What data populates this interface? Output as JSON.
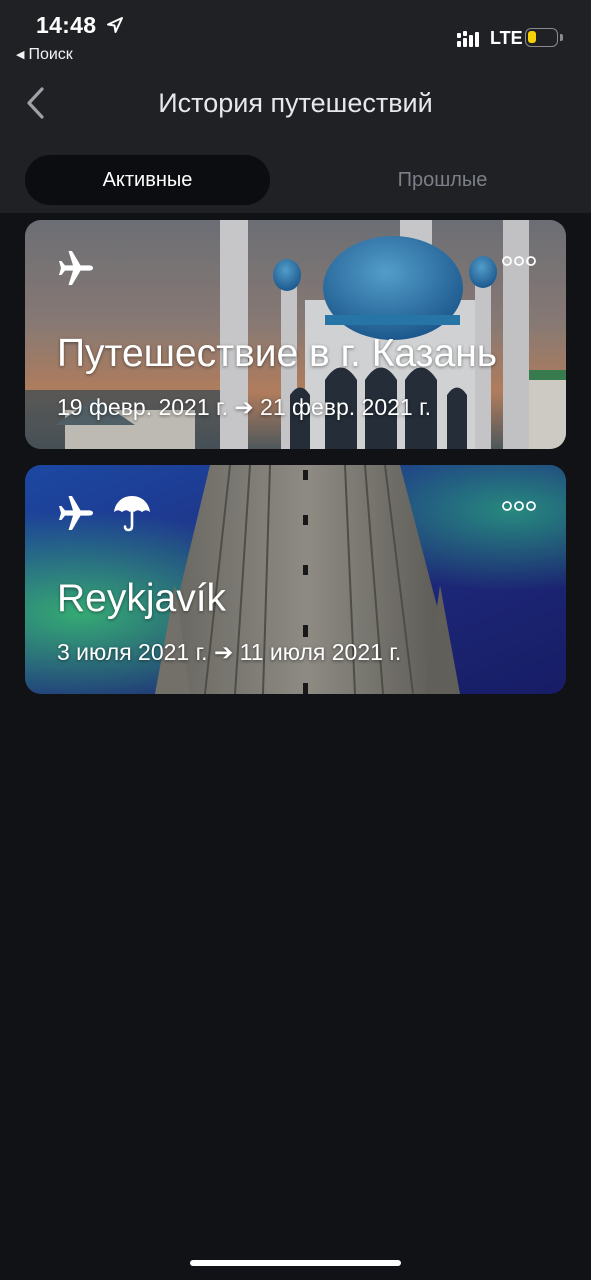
{
  "status_bar": {
    "time": "14:48",
    "back_app": "Поиск",
    "network": "LTE",
    "battery_level": 0.3,
    "battery_color": "#f5d10a"
  },
  "nav": {
    "title": "История путешествий"
  },
  "tabs": [
    {
      "label": "Активные",
      "active": true
    },
    {
      "label": "Прошлые",
      "active": false
    }
  ],
  "trips": [
    {
      "title": "Путешествие в г. Казань",
      "dates": "19 февр. 2021 г. ➔ 21 февр. 2021 г.",
      "icons": [
        "airplane-icon"
      ]
    },
    {
      "title": "Reykjavík",
      "dates": "3 июля 2021 г. ➔ 11 июля 2021 г.",
      "icons": [
        "airplane-icon",
        "umbrella-icon"
      ]
    }
  ],
  "colors": {
    "background": "#111216",
    "header": "#1f2125",
    "active_tab": "#0c0d10",
    "inactive_tab_text": "#7c7f87"
  }
}
